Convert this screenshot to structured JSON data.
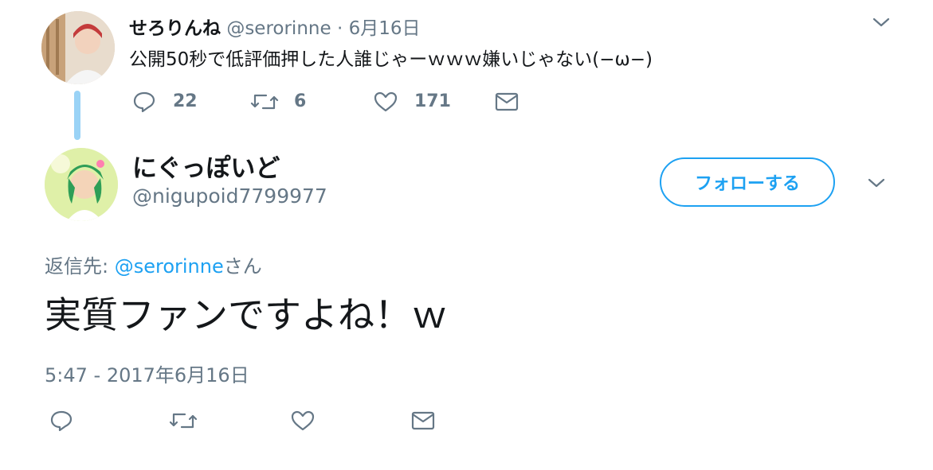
{
  "parent_tweet": {
    "display_name": "せろりんね",
    "handle": "@serorinne",
    "separator": "·",
    "date": "6月16日",
    "text": "公開50秒で低評価押した人誰じゃーｗｗｗ嫌いじゃない(−ω−)",
    "actions": {
      "reply_count": "22",
      "retweet_count": "6",
      "like_count": "171"
    }
  },
  "main_tweet": {
    "display_name": "にぐっぽいど",
    "handle": "@nigupoid7799977",
    "follow_label": "フォローする",
    "reply_prefix": "返信先: ",
    "reply_to": "@serorinne",
    "reply_suffix": "さん",
    "text": "実質ファンですよね！ｗ",
    "timestamp": "5:47 - 2017年6月16日"
  },
  "icons": [
    "chevron-down-icon",
    "reply-icon",
    "retweet-icon",
    "like-icon",
    "message-icon"
  ],
  "colors": {
    "accent": "#1da1f2",
    "thread_line": "#9ad3f6",
    "secondary_text": "#657786"
  }
}
